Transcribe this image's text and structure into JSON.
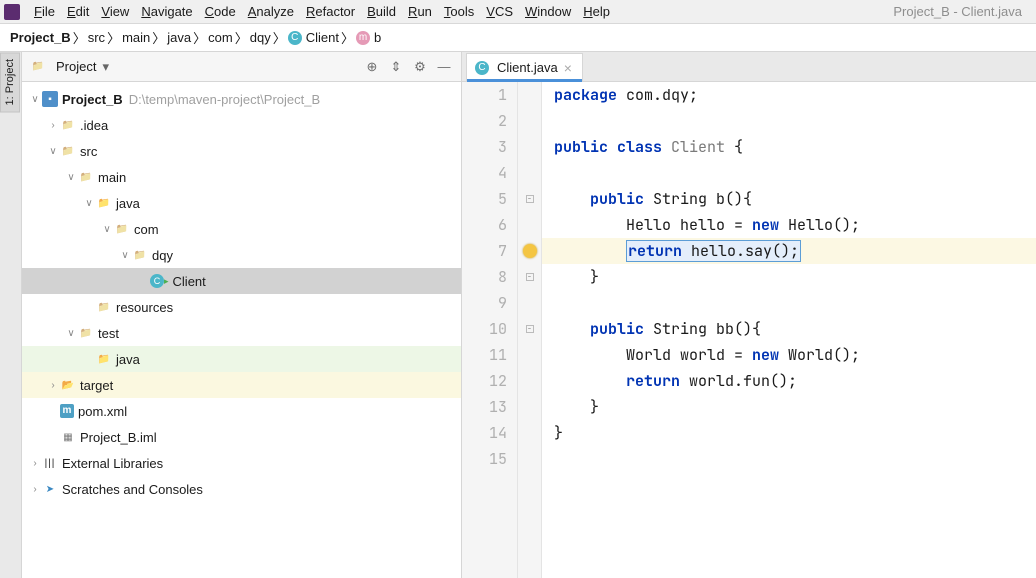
{
  "title": "Project_B - Client.java",
  "menu": [
    "File",
    "Edit",
    "View",
    "Navigate",
    "Code",
    "Analyze",
    "Refactor",
    "Build",
    "Run",
    "Tools",
    "VCS",
    "Window",
    "Help"
  ],
  "breadcrumbs": [
    {
      "label": "Project_B",
      "bold": true
    },
    {
      "label": "src"
    },
    {
      "label": "main"
    },
    {
      "label": "java"
    },
    {
      "label": "com"
    },
    {
      "label": "dqy"
    },
    {
      "label": "Client",
      "icon": "class"
    },
    {
      "label": "b",
      "icon": "method"
    }
  ],
  "project_panel": {
    "title": "Project",
    "tree": [
      {
        "d": 0,
        "arrow": "open",
        "icon": "root",
        "label": "Project_B",
        "path": "D:\\temp\\maven-project\\Project_B",
        "bold": true
      },
      {
        "d": 1,
        "arrow": "close",
        "icon": "folder",
        "label": ".idea"
      },
      {
        "d": 1,
        "arrow": "open",
        "icon": "folder",
        "label": "src"
      },
      {
        "d": 2,
        "arrow": "open",
        "icon": "folder",
        "label": "main"
      },
      {
        "d": 3,
        "arrow": "open",
        "icon": "blue",
        "label": "java"
      },
      {
        "d": 4,
        "arrow": "open",
        "icon": "folder",
        "label": "com"
      },
      {
        "d": 5,
        "arrow": "open",
        "icon": "folder",
        "label": "dqy"
      },
      {
        "d": 6,
        "arrow": "none",
        "icon": "class",
        "label": "Client",
        "selected": true,
        "runnable": true
      },
      {
        "d": 3,
        "arrow": "none",
        "icon": "folder",
        "label": "resources"
      },
      {
        "d": 2,
        "arrow": "open",
        "icon": "folder",
        "label": "test"
      },
      {
        "d": 3,
        "arrow": "none",
        "icon": "green",
        "label": "java",
        "hl": "green"
      },
      {
        "d": 1,
        "arrow": "close",
        "icon": "orange",
        "label": "target",
        "hl": "yellow"
      },
      {
        "d": 1,
        "arrow": "none",
        "icon": "m",
        "label": "pom.xml"
      },
      {
        "d": 1,
        "arrow": "none",
        "icon": "iml",
        "label": "Project_B.iml"
      },
      {
        "d": 0,
        "arrow": "close",
        "icon": "lib",
        "label": "External Libraries"
      },
      {
        "d": 0,
        "arrow": "close",
        "icon": "scratch",
        "label": "Scratches and Consoles"
      }
    ]
  },
  "editor": {
    "tab": {
      "label": "Client.java",
      "icon": "class"
    },
    "lines": [
      {
        "n": 1,
        "html": "<span class='kw'>package</span> com.dqy;"
      },
      {
        "n": 2,
        "html": ""
      },
      {
        "n": 3,
        "html": "<span class='kw'>public class</span> <span class='id'>Client</span> {"
      },
      {
        "n": 4,
        "html": ""
      },
      {
        "n": 5,
        "html": "    <span class='kw'>public</span> String b(){",
        "fold": "-"
      },
      {
        "n": 6,
        "html": "        Hello hello = <span class='kw'>new</span> Hello();"
      },
      {
        "n": 7,
        "html": "        <span class='sel-box'><span class='kw'>return</span> hello.say();</span>",
        "hl": true,
        "bulb": true
      },
      {
        "n": 8,
        "html": "    }",
        "fold": "-"
      },
      {
        "n": 9,
        "html": ""
      },
      {
        "n": 10,
        "html": "    <span class='kw'>public</span> String bb(){",
        "fold": "-"
      },
      {
        "n": 11,
        "html": "        World world = <span class='kw'>new</span> World();"
      },
      {
        "n": 12,
        "html": "        <span class='kw'>return</span> world.fun();"
      },
      {
        "n": 13,
        "html": "    }"
      },
      {
        "n": 14,
        "html": "}"
      },
      {
        "n": 15,
        "html": ""
      }
    ]
  },
  "side_tab": "1: Project"
}
